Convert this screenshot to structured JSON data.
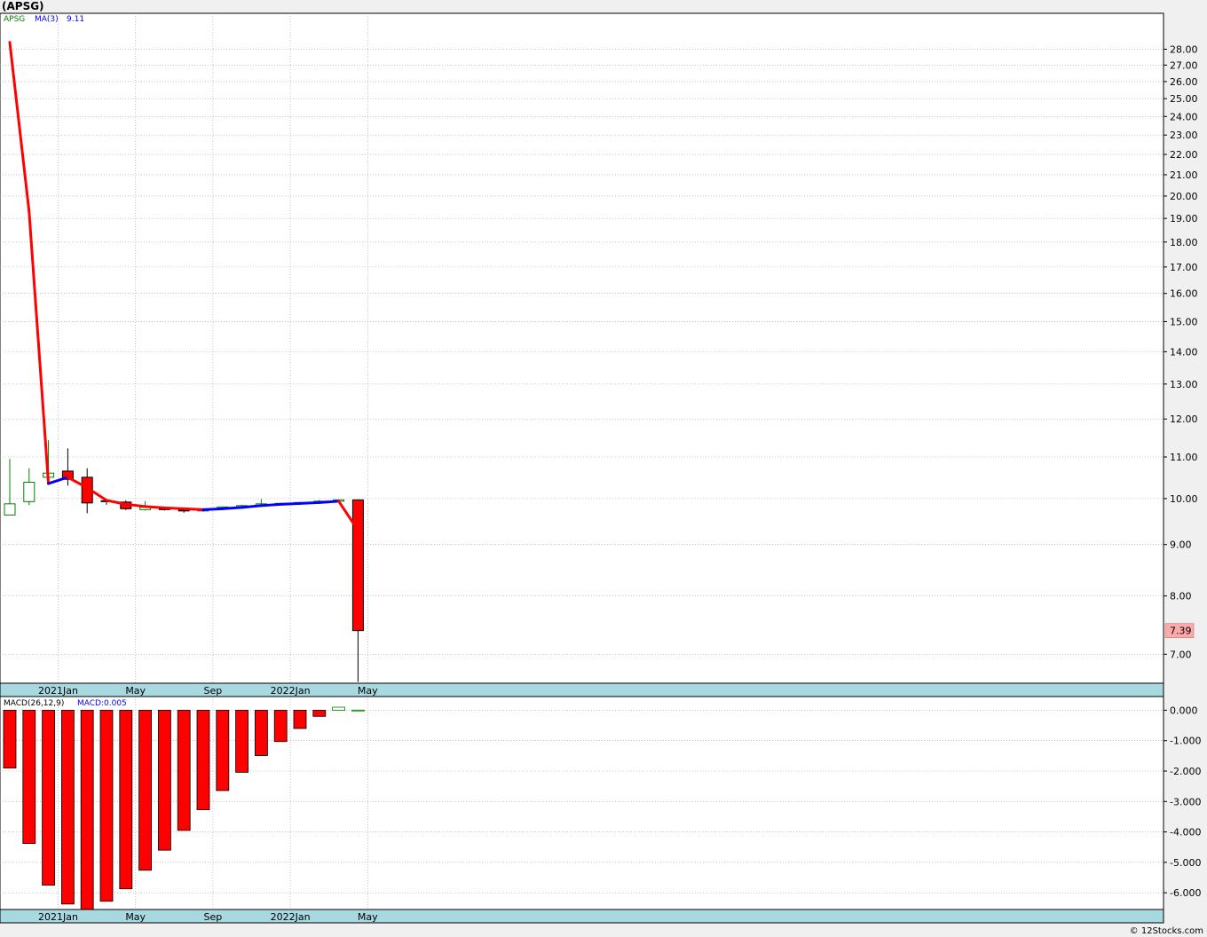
{
  "title": "(APSG)",
  "footer": "© 12Stocks.com",
  "chart_data": [
    {
      "type": "candlestick",
      "legend": {
        "symbol": "APSG",
        "ma_label": "MA(3)",
        "ma_value": "9.11"
      },
      "colors": {
        "up": "#008000",
        "down": "#ff0000",
        "ma_up": "#0000ff",
        "ma_down": "#ff0000",
        "band": "#a8d8e0",
        "last_price_bg": "#ffaaaa"
      },
      "y_axis": {
        "scale": "log",
        "range": [
          6.55,
          30.4
        ],
        "ticks": [
          7,
          8,
          9,
          10,
          11,
          12,
          13,
          14,
          15,
          16,
          17,
          18,
          19,
          20,
          21,
          22,
          23,
          24,
          25,
          26,
          27,
          28
        ],
        "tick_labels": [
          "7.00",
          "8.00",
          "9.00",
          "10.00",
          "11.00",
          "12.00",
          "13.00",
          "14.00",
          "15.00",
          "16.00",
          "17.00",
          "18.00",
          "19.00",
          "20.00",
          "21.00",
          "22.00",
          "23.00",
          "24.00",
          "25.00",
          "26.00",
          "27.00",
          "28.00"
        ]
      },
      "last_price": {
        "value": 7.39,
        "label": "7.39"
      },
      "x_axis": {
        "labels": [
          "2021Jan",
          "May",
          "Sep",
          "2022Jan",
          "May"
        ],
        "label_index": [
          2.5,
          6.5,
          10.5,
          14.5,
          18.5
        ]
      },
      "grid": true,
      "candles": [
        {
          "o": 9.63,
          "h": 10.95,
          "l": 9.63,
          "c": 9.88
        },
        {
          "o": 9.93,
          "h": 10.72,
          "l": 9.85,
          "c": 10.38
        },
        {
          "o": 10.5,
          "h": 11.43,
          "l": 10.33,
          "c": 10.6
        },
        {
          "o": 10.65,
          "h": 11.22,
          "l": 10.3,
          "c": 10.45
        },
        {
          "o": 10.5,
          "h": 10.72,
          "l": 9.67,
          "c": 9.9
        },
        {
          "o": 9.95,
          "h": 9.98,
          "l": 9.86,
          "c": 9.94
        },
        {
          "o": 9.92,
          "h": 9.96,
          "l": 9.74,
          "c": 9.77
        },
        {
          "o": 9.75,
          "h": 9.94,
          "l": 9.73,
          "c": 9.8
        },
        {
          "o": 9.77,
          "h": 9.8,
          "l": 9.73,
          "c": 9.76
        },
        {
          "o": 9.74,
          "h": 9.78,
          "l": 9.68,
          "c": 9.73
        },
        {
          "o": 9.72,
          "h": 9.78,
          "l": 9.7,
          "c": 9.75
        },
        {
          "o": 9.76,
          "h": 9.82,
          "l": 9.75,
          "c": 9.81
        },
        {
          "o": 9.8,
          "h": 9.86,
          "l": 9.79,
          "c": 9.84
        },
        {
          "o": 9.83,
          "h": 9.99,
          "l": 9.82,
          "c": 9.88
        },
        {
          "o": 9.88,
          "h": 9.9,
          "l": 9.86,
          "c": 9.89
        },
        {
          "o": 9.89,
          "h": 9.92,
          "l": 9.88,
          "c": 9.91
        },
        {
          "o": 9.9,
          "h": 9.97,
          "l": 9.89,
          "c": 9.94
        },
        {
          "o": 9.94,
          "h": 9.98,
          "l": 9.93,
          "c": 9.97
        },
        {
          "o": 9.97,
          "h": 9.98,
          "l": 6.57,
          "c": 7.39
        }
      ],
      "ma": [
        28.45,
        19.3,
        10.35,
        10.5,
        10.25,
        9.96,
        9.87,
        9.82,
        9.79,
        9.77,
        9.75,
        9.77,
        9.8,
        9.84,
        9.87,
        9.89,
        9.91,
        9.94,
        9.3
      ]
    },
    {
      "type": "bar",
      "legend": {
        "name": "MACD(26,12,9)",
        "value_label": "MACD:0.005"
      },
      "y_axis": {
        "range": [
          -6.55,
          0.45
        ],
        "ticks": [
          0,
          -1,
          -2,
          -3,
          -4,
          -5,
          -6
        ],
        "tick_labels": [
          "0.000",
          "-1.000",
          "-2.000",
          "-3.000",
          "-4.000",
          "-5.000",
          "-6.000"
        ]
      },
      "values": [
        -1.9,
        -4.38,
        -5.75,
        -6.37,
        -6.58,
        -6.28,
        -5.87,
        -5.26,
        -4.6,
        -3.95,
        -3.27,
        -2.64,
        -2.04,
        -1.49,
        -1.03,
        -0.6,
        -0.2,
        0.1,
        0.005
      ]
    }
  ]
}
